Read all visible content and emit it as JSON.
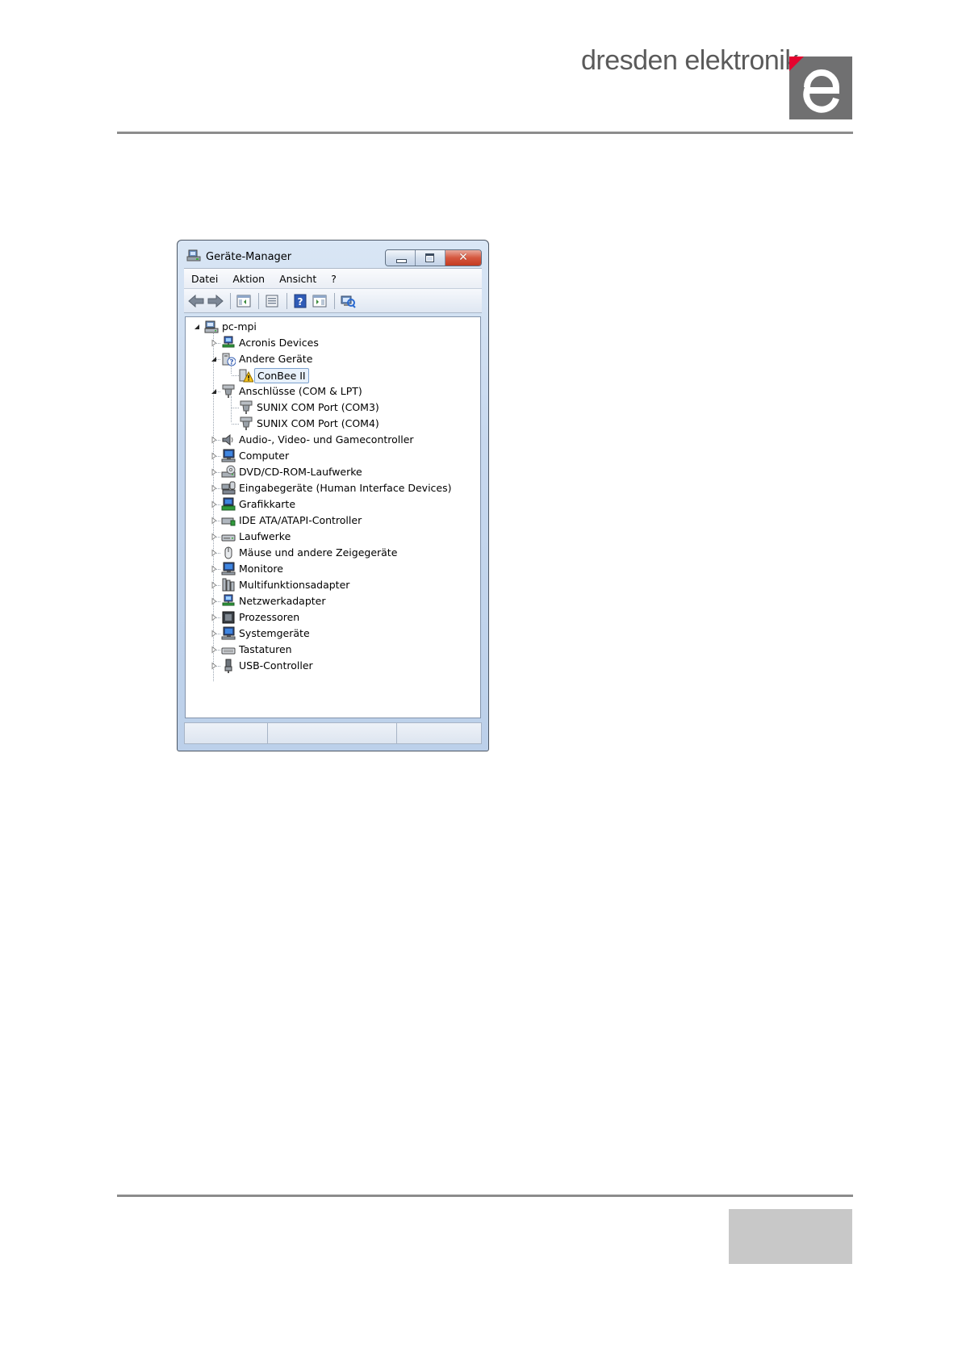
{
  "brand": {
    "name": "dresden elektronik",
    "logo_letter": "e",
    "accent": "#e4032e",
    "logo_gray": "#707071"
  },
  "window": {
    "title": "Geräte-Manager",
    "title_icon": "device-manager-icon",
    "buttons": {
      "minimize": "minimize-icon",
      "maximize": "maximize-icon",
      "close_glyph": "✕"
    },
    "menu": [
      {
        "label": "Datei"
      },
      {
        "label": "Aktion"
      },
      {
        "label": "Ansicht"
      },
      {
        "label": "?"
      }
    ],
    "toolbar": [
      {
        "icon": "back-arrow-icon"
      },
      {
        "icon": "forward-arrow-icon"
      },
      {
        "icon": "show-hide-console-tree-icon"
      },
      {
        "icon": "properties-icon"
      },
      {
        "icon": "help-icon"
      },
      {
        "icon": "show-hide-action-pane-icon"
      },
      {
        "icon": "scan-hardware-changes-icon"
      }
    ],
    "tree": [
      {
        "label": "pc-mpi",
        "level": 0,
        "expanded": true,
        "icon": "computer-network-icon"
      },
      {
        "label": "Acronis Devices",
        "level": 1,
        "expanded": false,
        "icon": "network-device-icon"
      },
      {
        "label": "Andere Geräte",
        "level": 1,
        "expanded": true,
        "icon": "unknown-device-icon"
      },
      {
        "label": "ConBee II",
        "level": 2,
        "icon": "warning-device-icon",
        "selected": true
      },
      {
        "label": "Anschlüsse (COM & LPT)",
        "level": 1,
        "expanded": true,
        "icon": "port-icon"
      },
      {
        "label": "SUNIX COM Port (COM3)",
        "level": 2,
        "icon": "port-icon"
      },
      {
        "label": "SUNIX COM Port (COM4)",
        "level": 2,
        "icon": "port-icon"
      },
      {
        "label": "Audio-, Video- und Gamecontroller",
        "level": 1,
        "expanded": false,
        "icon": "speaker-icon"
      },
      {
        "label": "Computer",
        "level": 1,
        "expanded": false,
        "icon": "monitor-icon"
      },
      {
        "label": "DVD/CD-ROM-Laufwerke",
        "level": 1,
        "expanded": false,
        "icon": "dvd-drive-icon"
      },
      {
        "label": "Eingabegeräte (Human Interface Devices)",
        "level": 1,
        "expanded": false,
        "icon": "hid-icon"
      },
      {
        "label": "Grafikkarte",
        "level": 1,
        "expanded": false,
        "icon": "display-adapter-icon"
      },
      {
        "label": "IDE ATA/ATAPI-Controller",
        "level": 1,
        "expanded": false,
        "icon": "ide-controller-icon"
      },
      {
        "label": "Laufwerke",
        "level": 1,
        "expanded": false,
        "icon": "disk-drive-icon"
      },
      {
        "label": "Mäuse und andere Zeigegeräte",
        "level": 1,
        "expanded": false,
        "icon": "mouse-icon"
      },
      {
        "label": "Monitore",
        "level": 1,
        "expanded": false,
        "icon": "monitor-icon"
      },
      {
        "label": "Multifunktionsadapter",
        "level": 1,
        "expanded": false,
        "icon": "multifunction-adapter-icon"
      },
      {
        "label": "Netzwerkadapter",
        "level": 1,
        "expanded": false,
        "icon": "network-device-icon"
      },
      {
        "label": "Prozessoren",
        "level": 1,
        "expanded": false,
        "icon": "processor-icon"
      },
      {
        "label": "Systemgeräte",
        "level": 1,
        "expanded": false,
        "icon": "monitor-icon"
      },
      {
        "label": "Tastaturen",
        "level": 1,
        "expanded": false,
        "icon": "keyboard-icon"
      },
      {
        "label": "USB-Controller",
        "level": 1,
        "expanded": false,
        "icon": "usb-icon"
      }
    ]
  }
}
